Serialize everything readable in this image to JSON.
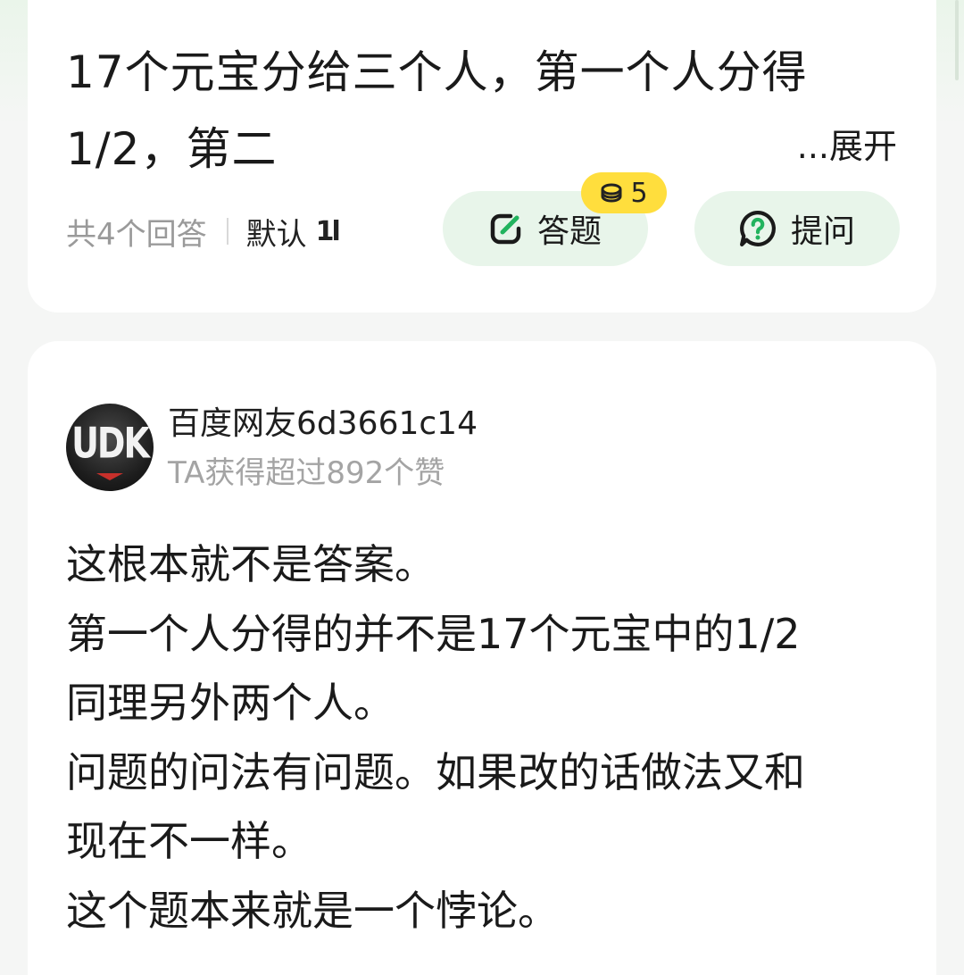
{
  "question": {
    "title": "17个元宝分给三个人，第一个人分得1/2，第二",
    "expand_label": "...展开",
    "answer_count": "共4个回答",
    "sort_label": "默认",
    "sort_icon": "sort-toggle-icon",
    "answer_button_label": "答题",
    "answer_reward": "5",
    "ask_button_label": "提问"
  },
  "answer": {
    "author_name": "百度网友6d3661c14",
    "author_likes": "TA获得超过892个赞",
    "avatar_text": "UDK",
    "lines": [
      "这根本就不是答案。",
      "第一个人分得的并不是17个元宝中的1/2",
      "同理另外两个人。",
      "问题的问法有问题。如果改的话做法又和",
      "现在不一样。",
      "这个题本来就是一个悖论。"
    ]
  },
  "colors": {
    "accent_green": "#22b35e",
    "pill_bg": "#e8f5ea",
    "badge_yellow": "#ffde3d"
  }
}
